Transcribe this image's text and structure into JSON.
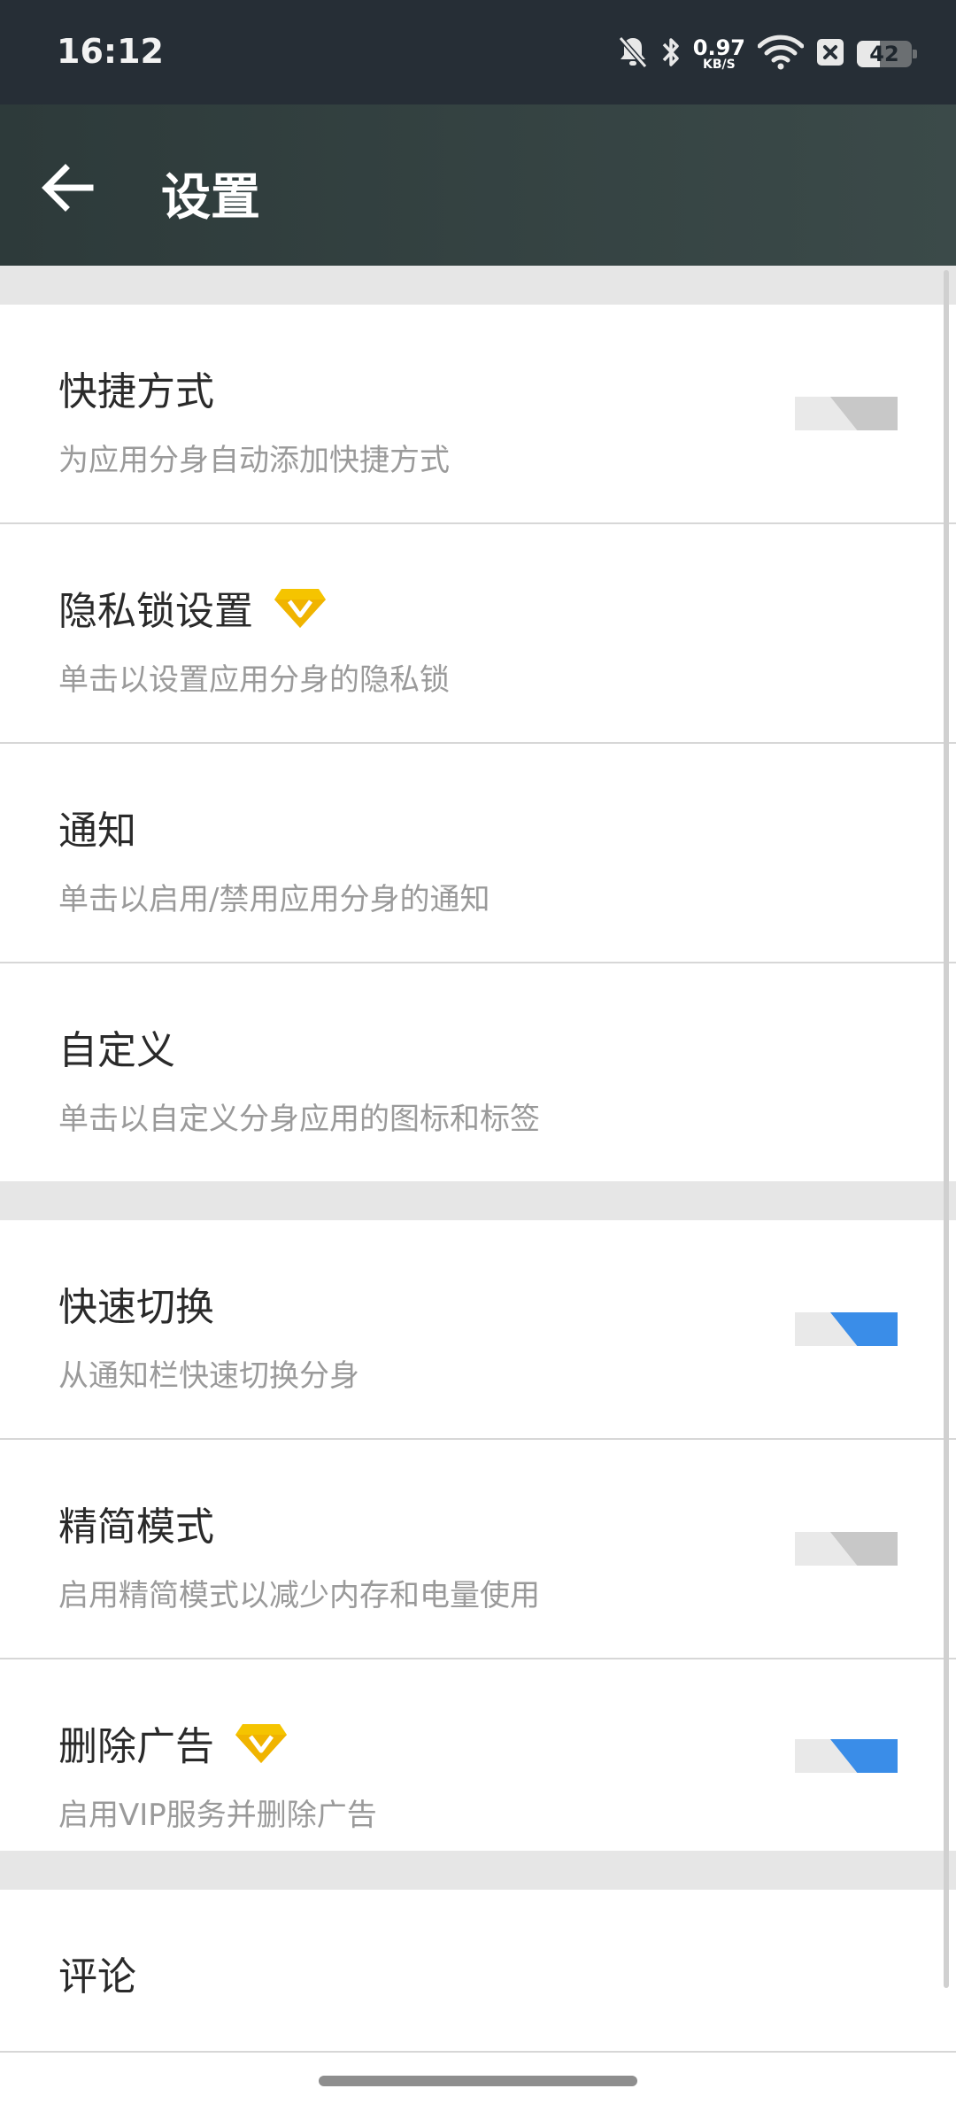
{
  "status_bar": {
    "time": "16:12",
    "net_speed_value": "0.97",
    "net_speed_unit": "KB/S",
    "battery_level": "42",
    "icons": [
      "bell-muted-icon",
      "bluetooth-icon",
      "wifi-icon",
      "close-box-icon",
      "battery-icon"
    ]
  },
  "app_bar": {
    "title": "设置",
    "back_icon": "arrow-left-icon"
  },
  "settings": [
    {
      "title": "快捷方式",
      "subtitle": "为应用分身自动添加快捷方式",
      "toggle": "off",
      "vip": false
    },
    {
      "title": "隐私锁设置",
      "subtitle": "单击以设置应用分身的隐私锁",
      "toggle": null,
      "vip": true
    },
    {
      "title": "通知",
      "subtitle": "单击以启用/禁用应用分身的通知",
      "toggle": null,
      "vip": false
    },
    {
      "title": "自定义",
      "subtitle": "单击以自定义分身应用的图标和标签",
      "toggle": null,
      "vip": false
    },
    {
      "title": "快速切换",
      "subtitle": "从通知栏快速切换分身",
      "toggle": "on",
      "vip": false
    },
    {
      "title": "精简模式",
      "subtitle": "启用精简模式以减少内存和电量使用",
      "toggle": "off",
      "vip": false
    },
    {
      "title": "删除广告",
      "subtitle": "启用VIP服务并删除广告",
      "toggle": "on",
      "vip": true
    },
    {
      "title": "评论"
    }
  ],
  "colors": {
    "status_bar": "#262e36",
    "app_bar": "#33403f",
    "toggle_on": "#3a8de8",
    "toggle_off": "#c8c8c8",
    "vip_gold": "#f5c400"
  }
}
